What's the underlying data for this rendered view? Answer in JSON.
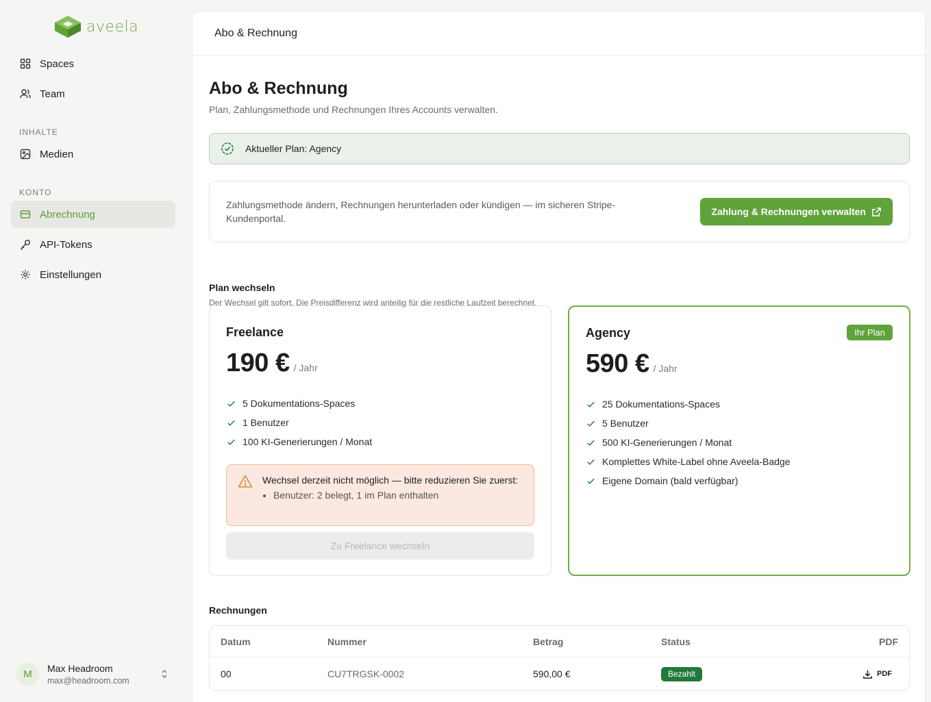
{
  "brand": {
    "name": "aveela",
    "accent": "#5fa33a"
  },
  "sidebar": {
    "items": [
      {
        "label": "Spaces",
        "icon": "grid-icon"
      },
      {
        "label": "Team",
        "icon": "users-icon"
      }
    ],
    "sections": [
      {
        "title": "INHALTE",
        "items": [
          {
            "label": "Medien",
            "icon": "image-icon"
          }
        ]
      },
      {
        "title": "KONTO",
        "items": [
          {
            "label": "Abrechnung",
            "icon": "credit-card-icon",
            "active": true
          },
          {
            "label": "API-Tokens",
            "icon": "key-icon"
          },
          {
            "label": "Einstellungen",
            "icon": "gear-icon"
          }
        ]
      }
    ],
    "user": {
      "initial": "M",
      "name": "Max Headroom",
      "email": "max@headroom.com"
    }
  },
  "topbar": {
    "title": "Abo & Rechnung"
  },
  "page": {
    "title": "Abo & Rechnung",
    "subtitle": "Plan, Zahlungsmethode und Rechnungen Ihres Accounts verwalten.",
    "current_plan_banner": "Aktueller Plan: Agency",
    "portal": {
      "text": "Zahlungsmethode ändern, Rechnungen herunterladen oder kündigen — im sicheren Stripe-Kundenportal.",
      "button": "Zahlung & Rechnungen verwalten"
    },
    "plan_switch": {
      "title": "Plan wechseln",
      "subtitle": "Der Wechsel gilt sofort. Die Preisdifferenz wird anteilig für die restliche Laufzeit berechnet.",
      "plans": [
        {
          "name": "Freelance",
          "price": "190 €",
          "unit": "/ Jahr",
          "features": [
            "5 Dokumentations-Spaces",
            "1 Benutzer",
            "100 KI-Generierungen / Monat"
          ],
          "warning": {
            "title": "Wechsel derzeit nicht möglich — bitte reduzieren Sie zuerst:",
            "items": [
              "Benutzer: 2 belegt, 1 im Plan enthalten"
            ]
          },
          "button": "Zu Freelance wechseln"
        },
        {
          "name": "Agency",
          "price": "590 €",
          "unit": "/ Jahr",
          "badge": "Ihr Plan",
          "features": [
            "25 Dokumentations-Spaces",
            "5 Benutzer",
            "500 KI-Generierungen / Monat",
            "Komplettes White-Label ohne Aveela-Badge",
            "Eigene Domain (bald verfügbar)"
          ]
        }
      ]
    },
    "invoices": {
      "title": "Rechnungen",
      "columns": [
        "Datum",
        "Nummer",
        "Betrag",
        "Status",
        "PDF"
      ],
      "rows": [
        {
          "date": "00",
          "number": "CU7TRGSK-0002",
          "amount": "590,00 €",
          "status": "Bezahlt",
          "pdf": "PDF"
        }
      ]
    }
  }
}
